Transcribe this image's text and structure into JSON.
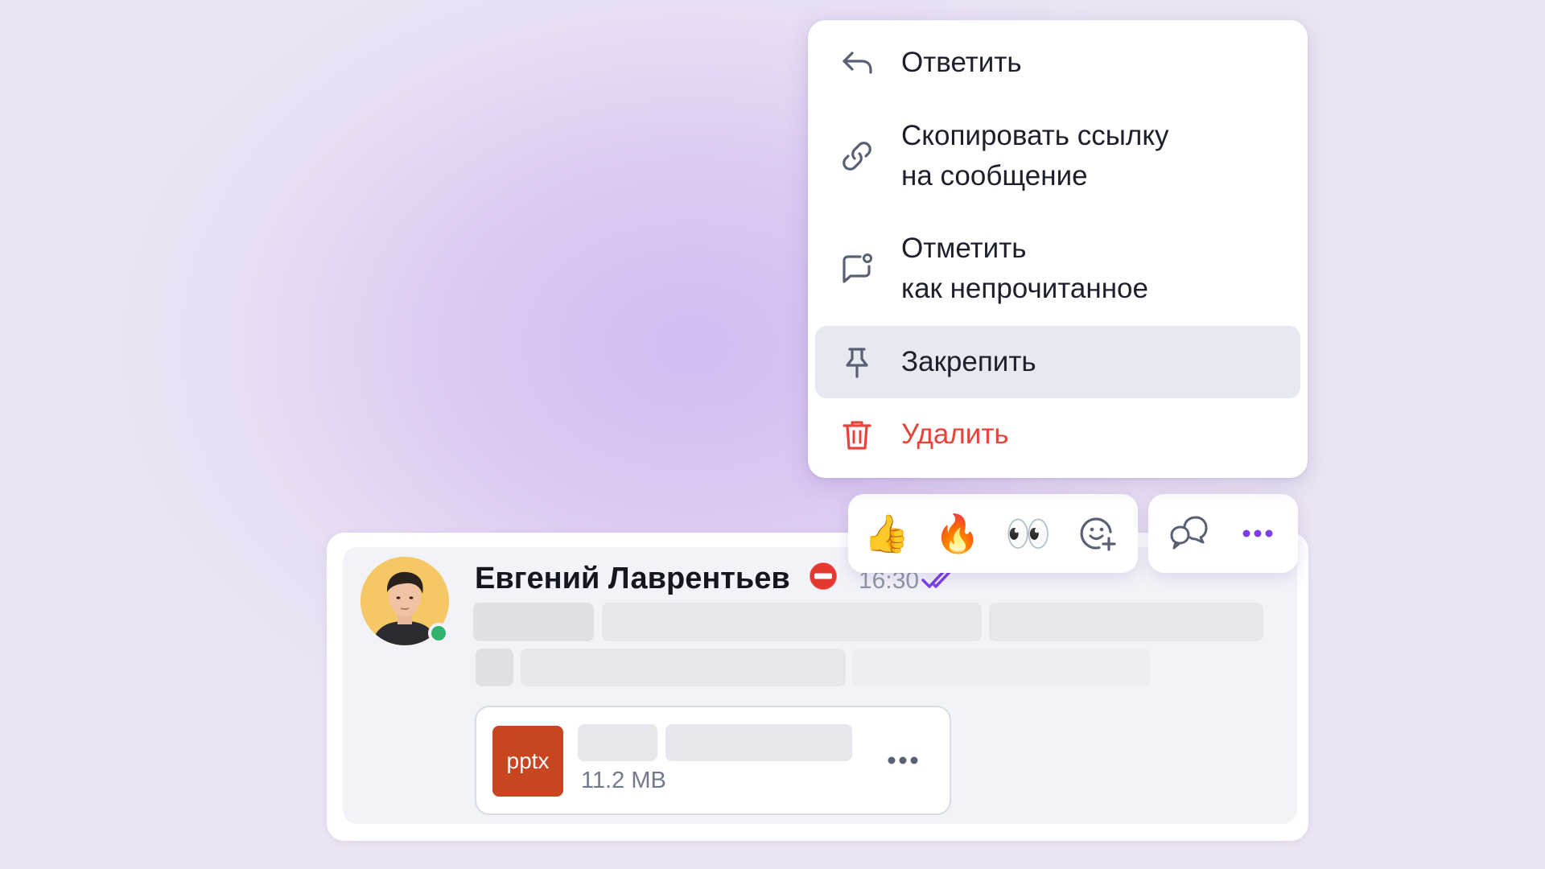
{
  "menu": {
    "items": [
      {
        "id": "reply",
        "label": "Ответить",
        "icon": "reply-arrow-icon"
      },
      {
        "id": "copy-link",
        "label": "Скопировать ссылку\nна сообщение",
        "icon": "link-icon"
      },
      {
        "id": "mark-unread",
        "label": "Отметить\nкак непрочитанное",
        "icon": "chat-bubble-dot-icon"
      },
      {
        "id": "pin",
        "label": "Закрепить",
        "icon": "pin-icon",
        "highlighted": true
      },
      {
        "id": "delete",
        "label": "Удалить",
        "icon": "trash-icon",
        "danger_color": "#e8433a"
      }
    ]
  },
  "reactions": {
    "quick": [
      "👍",
      "🔥",
      "👀"
    ],
    "add_reaction_icon": "smiley-plus-icon",
    "thread_icon": "speech-bubbles-icon",
    "more_icon": "ellipsis-icon",
    "accent_color": "#7b3fe4"
  },
  "message": {
    "author": "Евгений Лаврентьев",
    "status_icon": "do-not-disturb-icon",
    "time": "16:30",
    "read_icon": "double-check-icon",
    "online": true,
    "attachment": {
      "type": "pptx",
      "size": "11.2 MB"
    }
  },
  "colors": {
    "badge_pptx": "#c8461f",
    "online": "#2fb36c",
    "menu_text": "#1d1f2c",
    "danger": "#e8433a"
  }
}
